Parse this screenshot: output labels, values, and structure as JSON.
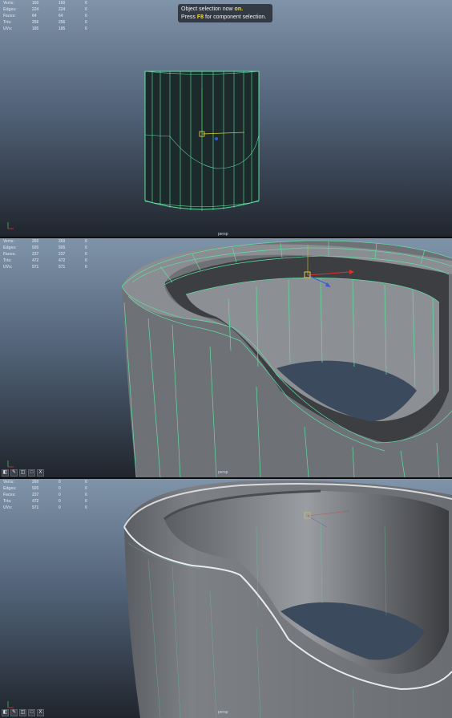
{
  "toast": {
    "line1_prefix": "Object selection now ",
    "line1_highlight": "on.",
    "line2_prefix": "Press ",
    "line2_key": "F8",
    "line2_suffix": " for component selection."
  },
  "panels": [
    {
      "hud": [
        {
          "label": "Verts:",
          "v1": "160",
          "v2": "160",
          "v3": "0"
        },
        {
          "label": "Edges:",
          "v1": "224",
          "v2": "224",
          "v3": "0"
        },
        {
          "label": "Faces:",
          "v1": "64",
          "v2": "64",
          "v3": "0"
        },
        {
          "label": "Tris:",
          "v1": "256",
          "v2": "256",
          "v3": "0"
        },
        {
          "label": "UVs:",
          "v1": "185",
          "v2": "185",
          "v3": "0"
        }
      ],
      "camera": "persp"
    },
    {
      "hud": [
        {
          "label": "Verts:",
          "v1": "260",
          "v2": "260",
          "v3": "0"
        },
        {
          "label": "Edges:",
          "v1": "505",
          "v2": "505",
          "v3": "0"
        },
        {
          "label": "Faces:",
          "v1": "237",
          "v2": "237",
          "v3": "0"
        },
        {
          "label": "Tris:",
          "v1": "472",
          "v2": "472",
          "v3": "0"
        },
        {
          "label": "UVs:",
          "v1": "571",
          "v2": "571",
          "v3": "0"
        }
      ],
      "camera": "persp"
    },
    {
      "hud": [
        {
          "label": "Verts:",
          "v1": "260",
          "v2": "0",
          "v3": "0"
        },
        {
          "label": "Edges:",
          "v1": "505",
          "v2": "0",
          "v3": "0"
        },
        {
          "label": "Faces:",
          "v1": "237",
          "v2": "0",
          "v3": "0"
        },
        {
          "label": "Tris:",
          "v1": "472",
          "v2": "0",
          "v3": "0"
        },
        {
          "label": "UVs:",
          "v1": "571",
          "v2": "0",
          "v3": "0"
        }
      ],
      "camera": "persp"
    }
  ],
  "toolbar": {
    "close": "X"
  },
  "colors": {
    "wire": "#5fe0a0",
    "accent": "#f2d94e",
    "manip_x": "#d9342b",
    "manip_y": "#c9c430",
    "manip_z": "#2f5fd6"
  }
}
